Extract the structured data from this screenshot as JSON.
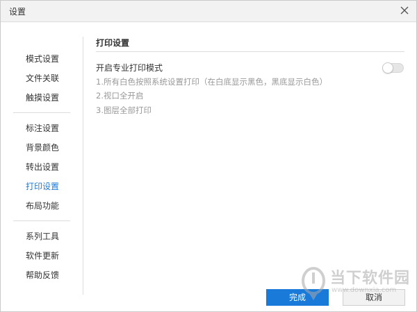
{
  "window": {
    "title": "设置"
  },
  "sidebar": {
    "groups": [
      {
        "items": [
          {
            "label": "模式设置"
          },
          {
            "label": "文件关联"
          },
          {
            "label": "触摸设置"
          }
        ]
      },
      {
        "items": [
          {
            "label": "标注设置"
          },
          {
            "label": "背景颜色"
          },
          {
            "label": "转出设置"
          },
          {
            "label": "打印设置",
            "active": true
          },
          {
            "label": "布局功能"
          }
        ]
      },
      {
        "items": [
          {
            "label": "系列工具"
          },
          {
            "label": "软件更新"
          },
          {
            "label": "帮助反馈"
          }
        ]
      }
    ]
  },
  "main": {
    "section_title": "打印设置",
    "option_label": "开启专业打印模式",
    "option_enabled": false,
    "descriptions": [
      "1.所有白色按照系统设置打印（在白底显示黑色，黑底显示白色）",
      "2.视口全开启",
      "3.图层全部打印"
    ]
  },
  "footer": {
    "confirm_label": "完成",
    "cancel_label": "取消"
  },
  "watermark": {
    "text": "当下软件园",
    "url": "www.downxia.com"
  },
  "colors": {
    "accent": "#1a7ad9",
    "title_bar_bg": "#f2f2f2",
    "muted_text": "#999999"
  }
}
